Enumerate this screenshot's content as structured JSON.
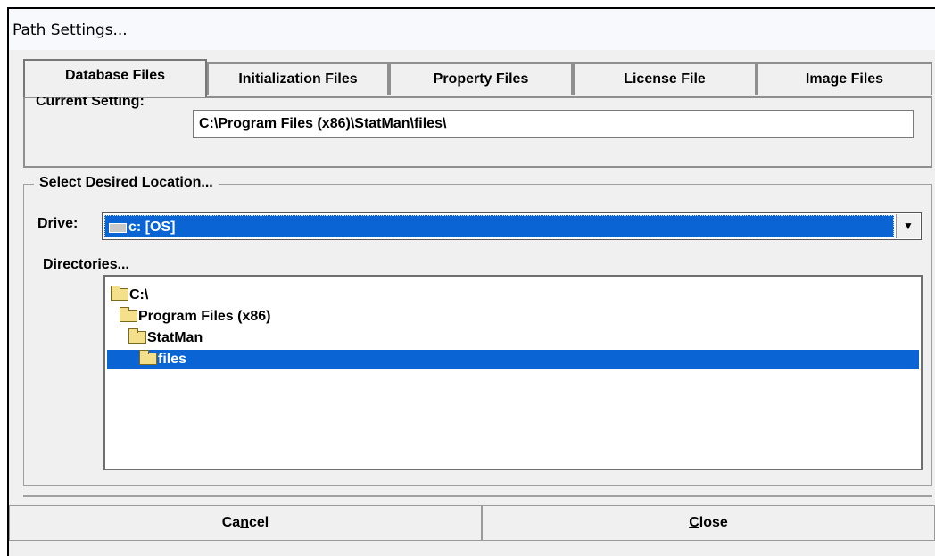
{
  "window": {
    "title": "Path Settings..."
  },
  "tabs": [
    {
      "label": "Database Files",
      "active": true
    },
    {
      "label": "Initialization Files",
      "active": false
    },
    {
      "label": "Property Files",
      "active": false
    },
    {
      "label": "License File",
      "active": false
    },
    {
      "label": "Image Files",
      "active": false
    }
  ],
  "current_setting": {
    "label": "Current Setting:",
    "value": "C:\\Program Files (x86)\\StatMan\\files\\"
  },
  "location": {
    "legend": "Select Desired Location...",
    "drive_label": "Drive:",
    "drive_value": "c: [OS]",
    "directories_label": "Directories...",
    "directories": [
      {
        "name": "C:\\",
        "selected": false
      },
      {
        "name": "Program Files (x86)",
        "selected": false
      },
      {
        "name": "StatMan",
        "selected": false
      },
      {
        "name": "files",
        "selected": true
      }
    ]
  },
  "buttons": {
    "cancel": {
      "pre": "Ca",
      "mnemonic": "n",
      "post": "cel"
    },
    "close": {
      "pre": "",
      "mnemonic": "C",
      "post": "lose"
    }
  },
  "colors": {
    "selection": "#0a64d4",
    "background": "#f0f0f0"
  }
}
